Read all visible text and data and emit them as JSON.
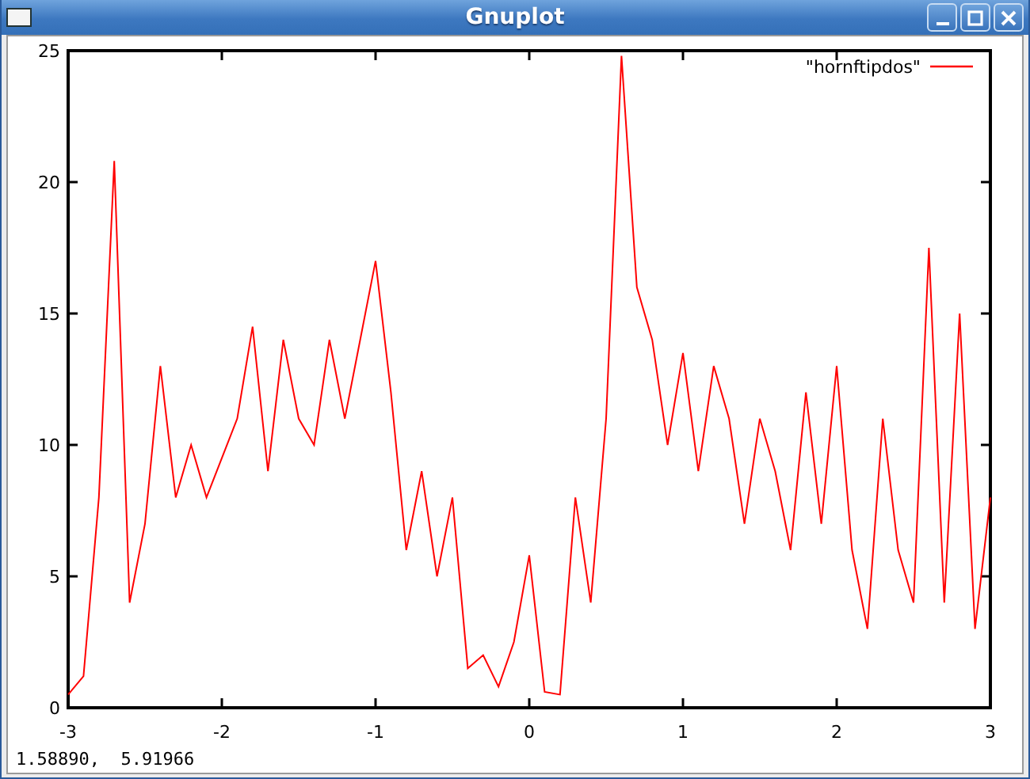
{
  "window": {
    "title": "Gnuplot"
  },
  "plot": {
    "chart_data": {
      "type": "line",
      "x": [
        -3,
        -2.9,
        -2.8,
        -2.7,
        -2.6,
        -2.5,
        -2.4,
        -2.3,
        -2.2,
        -2.1,
        -2,
        -1.9,
        -1.8,
        -1.7,
        -1.6,
        -1.5,
        -1.4,
        -1.3,
        -1.2,
        -1.1,
        -1,
        -0.9,
        -0.8,
        -0.7,
        -0.6,
        -0.5,
        -0.4,
        -0.3,
        -0.2,
        -0.1,
        0,
        0.1,
        0.2,
        0.3,
        0.4,
        0.5,
        0.6,
        0.7,
        0.8,
        0.9,
        1,
        1.1,
        1.2,
        1.3,
        1.4,
        1.5,
        1.6,
        1.7,
        1.8,
        1.9,
        2,
        2.1,
        2.2,
        2.3,
        2.4,
        2.5,
        2.6,
        2.7,
        2.8,
        2.9,
        3
      ],
      "series": [
        {
          "name": "\"hornftipdos\"",
          "color": "#ff0000",
          "values": [
            0.5,
            1.2,
            8,
            20.8,
            4,
            7,
            13,
            8,
            10,
            8,
            9.5,
            11,
            14.5,
            9,
            14,
            11,
            10,
            14,
            11,
            14,
            17,
            12,
            6,
            9,
            5,
            8,
            1.5,
            2,
            0.8,
            2.5,
            5.8,
            0.6,
            0.5,
            8,
            4,
            11,
            24.8,
            16,
            14,
            10,
            13.5,
            9,
            13,
            11,
            7,
            11,
            9,
            6,
            12,
            7,
            13,
            6,
            3,
            11,
            6,
            4,
            17.5,
            4,
            15,
            3,
            8
          ]
        }
      ],
      "xlim": [
        -3,
        3
      ],
      "ylim": [
        0,
        25
      ],
      "xticks": [
        -3,
        -2,
        -1,
        0,
        1,
        2,
        3
      ],
      "yticks": [
        0,
        5,
        10,
        15,
        20,
        25
      ]
    }
  },
  "status_bar": {
    "text": "1.58890,  5.91966"
  }
}
